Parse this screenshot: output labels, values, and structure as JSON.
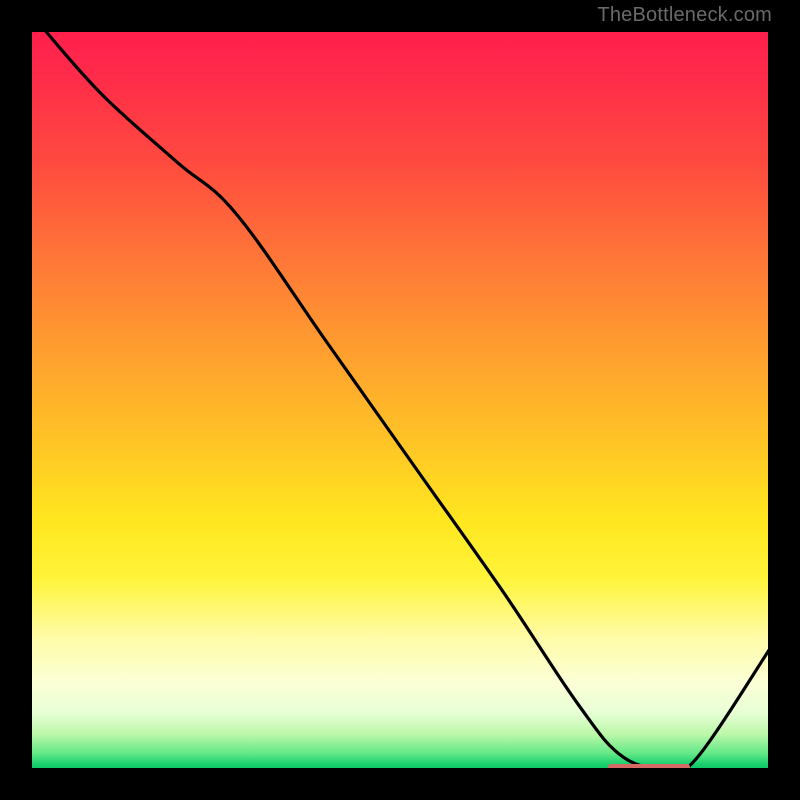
{
  "watermark": "TheBottleneck.com",
  "colors": {
    "line": "#000000",
    "optimal_bar": "#d46a63",
    "gradient_top": "#ff1f4d",
    "gradient_bottom": "#0bbd63",
    "border": "#000000"
  },
  "chart_data": {
    "type": "line",
    "title": "",
    "xlabel": "",
    "ylabel": "",
    "xlim": [
      0,
      100
    ],
    "ylim": [
      0,
      100
    ],
    "x": [
      2,
      10,
      20,
      28,
      40,
      52,
      64,
      74,
      80,
      86,
      90,
      100
    ],
    "values": [
      100,
      91,
      82,
      75,
      58,
      41,
      24,
      9,
      2,
      0.5,
      2,
      17
    ],
    "optimal_range_x": [
      78,
      89
    ],
    "optimal_bar_y": 0.6
  }
}
